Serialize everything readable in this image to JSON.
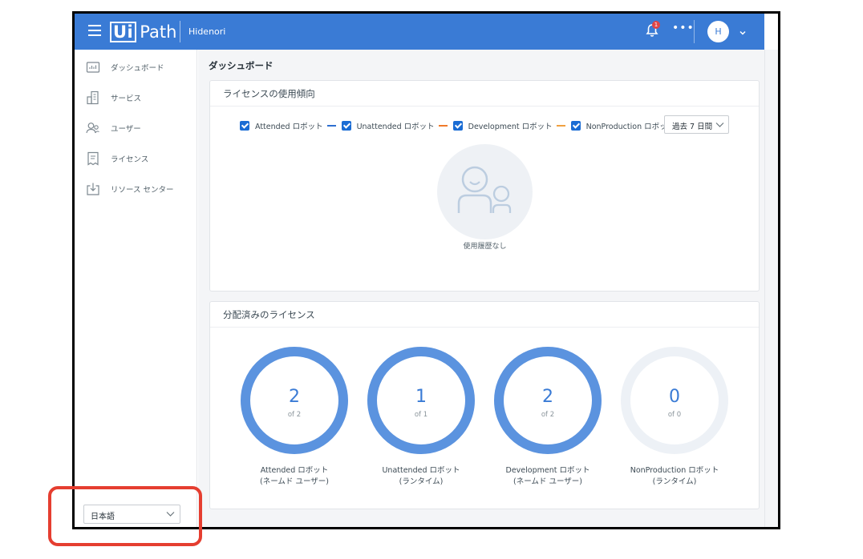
{
  "header": {
    "logo_ui": "Ui",
    "logo_path": "Path",
    "tenant": "Hidenori",
    "notification_count": "1",
    "more_label": "•••",
    "avatar_initial": "H",
    "colors": {
      "header_bg": "#3a7bd5",
      "badge": "#e04444"
    },
    "icons": [
      "menu-icon",
      "bell-icon",
      "more-icon",
      "chevron-down-icon"
    ]
  },
  "sidebar": {
    "items": [
      {
        "label": "ダッシュボード",
        "icon": "dashboard-icon"
      },
      {
        "label": "サービス",
        "icon": "services-icon"
      },
      {
        "label": "ユーザー",
        "icon": "users-icon"
      },
      {
        "label": "ライセンス",
        "icon": "license-icon"
      },
      {
        "label": "リソース センター",
        "icon": "download-icon"
      }
    ],
    "language": "日本語"
  },
  "main": {
    "page_title": "ダッシュボード",
    "usage": {
      "title": "ライセンスの使用傾向",
      "legend": [
        {
          "label": "Attended ロボット",
          "checked": true,
          "color": "#2e6fd0"
        },
        {
          "label": "Unattended ロボット",
          "checked": true,
          "color": "#f07a2a"
        },
        {
          "label": "Development ロボット",
          "checked": true,
          "color": "#f0a040"
        },
        {
          "label": "NonProduction ロボット",
          "checked": true,
          "color": "#7ed08e"
        }
      ],
      "period": "過去 7 日間",
      "empty_text": "使用履歴なし"
    },
    "allocated": {
      "title": "分配済みのライセンス",
      "items": [
        {
          "value": "2",
          "of": "of 2",
          "label1": "Attended ロボット",
          "label2": "(ネームド ユーザー)",
          "fraction": 1
        },
        {
          "value": "1",
          "of": "of 1",
          "label1": "Unattended ロボット",
          "label2": "(ランタイム)",
          "fraction": 1
        },
        {
          "value": "2",
          "of": "of 2",
          "label1": "Development ロボット",
          "label2": "(ネームド ユーザー)",
          "fraction": 1
        },
        {
          "value": "0",
          "of": "of 0",
          "label1": "NonProduction ロボット",
          "label2": "(ランタイム)",
          "fraction": 0
        }
      ],
      "colors": {
        "ring": "#5b93df",
        "ring_empty": "#edf1f6"
      }
    }
  }
}
